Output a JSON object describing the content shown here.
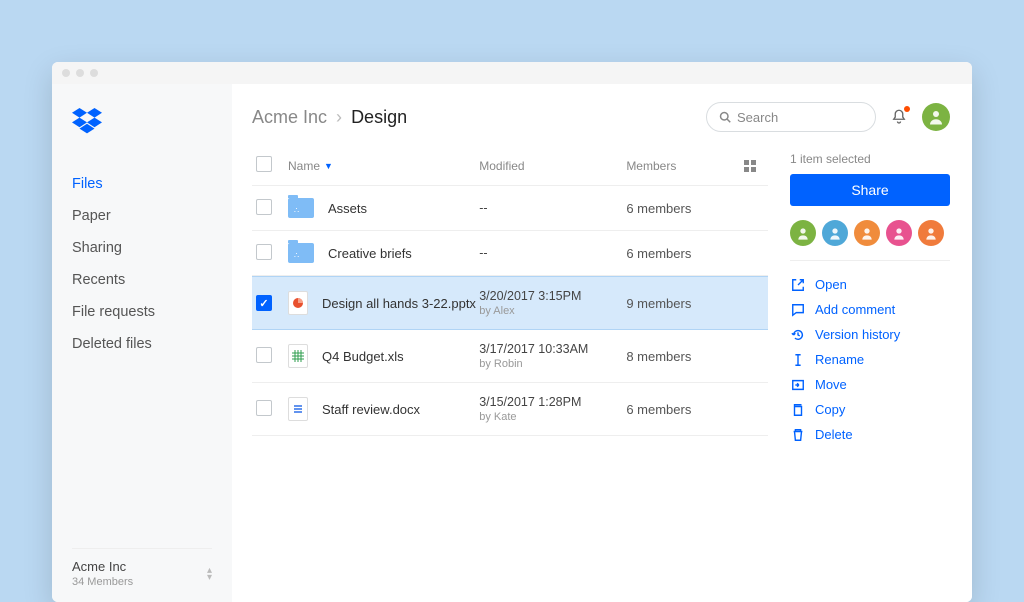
{
  "sidebar": {
    "nav": [
      "Files",
      "Paper",
      "Sharing",
      "Recents",
      "File requests",
      "Deleted files"
    ],
    "active_index": 0,
    "footer": {
      "name": "Acme Inc",
      "members": "34 Members"
    }
  },
  "breadcrumb": {
    "parent": "Acme Inc",
    "current": "Design"
  },
  "search": {
    "placeholder": "Search"
  },
  "columns": {
    "name": "Name",
    "modified": "Modified",
    "members": "Members"
  },
  "rows": [
    {
      "icon": "folder",
      "name": "Assets",
      "modified": "--",
      "by": "",
      "members": "6 members",
      "selected": false
    },
    {
      "icon": "folder",
      "name": "Creative briefs",
      "modified": "--",
      "by": "",
      "members": "6 members",
      "selected": false
    },
    {
      "icon": "pptx",
      "name": "Design all hands 3-22.pptx",
      "modified": "3/20/2017 3:15PM",
      "by": "by Alex",
      "members": "9 members",
      "selected": true
    },
    {
      "icon": "xls",
      "name": "Q4 Budget.xls",
      "modified": "3/17/2017 10:33AM",
      "by": "by Robin",
      "members": "8 members",
      "selected": false
    },
    {
      "icon": "docx",
      "name": "Staff review.docx",
      "modified": "3/15/2017 1:28PM",
      "by": "by Kate",
      "members": "6 members",
      "selected": false
    }
  ],
  "panel": {
    "selected_text": "1 item selected",
    "share": "Share",
    "member_colors": [
      "#7cb342",
      "#4fa8d8",
      "#f08c3c",
      "#e8528f",
      "#f07b3c"
    ],
    "actions": [
      {
        "icon": "open",
        "label": "Open"
      },
      {
        "icon": "comment",
        "label": "Add comment"
      },
      {
        "icon": "history",
        "label": "Version history"
      },
      {
        "icon": "rename",
        "label": "Rename"
      },
      {
        "icon": "move",
        "label": "Move"
      },
      {
        "icon": "copy",
        "label": "Copy"
      },
      {
        "icon": "delete",
        "label": "Delete"
      }
    ]
  }
}
